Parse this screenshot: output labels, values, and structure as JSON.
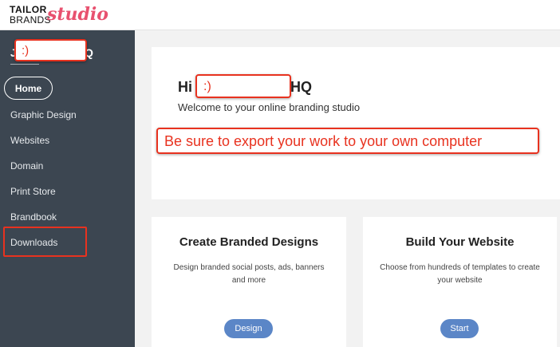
{
  "logo": {
    "line1": "TAILOR",
    "line2": "BRANDS",
    "script": "studio"
  },
  "sidebar": {
    "workspace_first": "J",
    "workspace_last": "Q",
    "items": [
      {
        "label": "Home"
      },
      {
        "label": "Graphic Design"
      },
      {
        "label": "Websites"
      },
      {
        "label": "Domain"
      },
      {
        "label": "Print Store"
      },
      {
        "label": "Brandbook"
      },
      {
        "label": "Downloads"
      }
    ]
  },
  "welcome": {
    "greeting": "Hi",
    "name_suffix": "HQ",
    "subtitle": "Welcome to your online branding studio"
  },
  "cards": [
    {
      "title": "Create Branded Designs",
      "description": "Design branded social posts, ads, banners and more",
      "button": "Design"
    },
    {
      "title": "Build Your Website",
      "description": "Choose from hundreds of templates to create your website",
      "button": "Start"
    }
  ],
  "annotations": {
    "smiley": ":)",
    "note": "Be sure to export your work to your own computer",
    "color": "#e8321f"
  }
}
